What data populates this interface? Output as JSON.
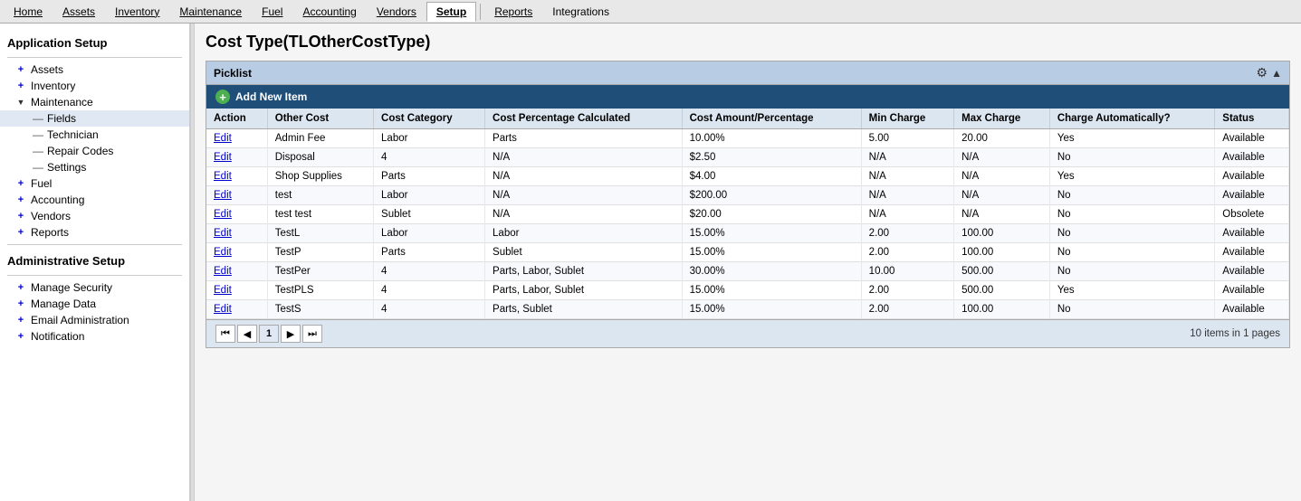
{
  "topnav": {
    "items": [
      {
        "label": "Home",
        "id": "home",
        "active": false,
        "underline": true
      },
      {
        "label": "Assets",
        "id": "assets",
        "active": false,
        "underline": true
      },
      {
        "label": "Inventory",
        "id": "inventory",
        "active": false,
        "underline": true
      },
      {
        "label": "Maintenance",
        "id": "maintenance",
        "active": false,
        "underline": true
      },
      {
        "label": "Fuel",
        "id": "fuel",
        "active": false,
        "underline": true
      },
      {
        "label": "Accounting",
        "id": "accounting",
        "active": false,
        "underline": true
      },
      {
        "label": "Vendors",
        "id": "vendors",
        "active": false,
        "underline": true
      },
      {
        "label": "Setup",
        "id": "setup",
        "active": true,
        "underline": true
      },
      {
        "label": "Reports",
        "id": "reports",
        "active": false,
        "underline": true
      },
      {
        "label": "Integrations",
        "id": "integrations",
        "active": false,
        "underline": false
      }
    ]
  },
  "sidebar": {
    "app_setup_title": "Application Setup",
    "admin_setup_title": "Administrative Setup",
    "app_items": [
      {
        "label": "Assets",
        "id": "assets"
      },
      {
        "label": "Inventory",
        "id": "inventory"
      },
      {
        "label": "Maintenance",
        "id": "maintenance",
        "expanded": true
      },
      {
        "label": "Fields",
        "id": "fields",
        "sub": true,
        "selected": true
      },
      {
        "label": "Technician",
        "id": "technician",
        "sub": true
      },
      {
        "label": "Repair Codes",
        "id": "repair-codes",
        "sub": true
      },
      {
        "label": "Settings",
        "id": "settings",
        "sub": true
      },
      {
        "label": "Fuel",
        "id": "fuel"
      },
      {
        "label": "Accounting",
        "id": "accounting"
      },
      {
        "label": "Vendors",
        "id": "vendors"
      },
      {
        "label": "Reports",
        "id": "reports"
      }
    ],
    "admin_items": [
      {
        "label": "Manage Security",
        "id": "manage-security"
      },
      {
        "label": "Manage Data",
        "id": "manage-data"
      },
      {
        "label": "Email Administration",
        "id": "email-admin"
      },
      {
        "label": "Notification",
        "id": "notification"
      }
    ]
  },
  "page": {
    "title": "Cost Type(TLOtherCostType)"
  },
  "picklist": {
    "header": "Picklist",
    "add_new_label": "Add New Item",
    "columns": [
      {
        "label": "Action",
        "id": "action"
      },
      {
        "label": "Other Cost",
        "id": "other-cost"
      },
      {
        "label": "Cost Category",
        "id": "cost-category"
      },
      {
        "label": "Cost Percentage Calculated",
        "id": "cost-pct-calc"
      },
      {
        "label": "Cost Amount/Percentage",
        "id": "cost-amt-pct"
      },
      {
        "label": "Min Charge",
        "id": "min-charge"
      },
      {
        "label": "Max Charge",
        "id": "max-charge"
      },
      {
        "label": "Charge Automatically?",
        "id": "charge-auto"
      },
      {
        "label": "Status",
        "id": "status"
      }
    ],
    "rows": [
      {
        "action": "Edit",
        "other_cost": "Admin Fee",
        "cost_category": "Labor",
        "cost_pct_calc": "Parts",
        "cost_amt_pct": "10.00%",
        "min_charge": "5.00",
        "max_charge": "20.00",
        "charge_auto": "Yes",
        "status": "Available"
      },
      {
        "action": "Edit",
        "other_cost": "Disposal",
        "cost_category": "4",
        "cost_pct_calc": "N/A",
        "cost_amt_pct": "$2.50",
        "min_charge": "N/A",
        "max_charge": "N/A",
        "charge_auto": "No",
        "status": "Available"
      },
      {
        "action": "Edit",
        "other_cost": "Shop Supplies",
        "cost_category": "Parts",
        "cost_pct_calc": "N/A",
        "cost_amt_pct": "$4.00",
        "min_charge": "N/A",
        "max_charge": "N/A",
        "charge_auto": "Yes",
        "status": "Available"
      },
      {
        "action": "Edit",
        "other_cost": "test",
        "cost_category": "Labor",
        "cost_pct_calc": "N/A",
        "cost_amt_pct": "$200.00",
        "min_charge": "N/A",
        "max_charge": "N/A",
        "charge_auto": "No",
        "status": "Available"
      },
      {
        "action": "Edit",
        "other_cost": "test test",
        "cost_category": "Sublet",
        "cost_pct_calc": "N/A",
        "cost_amt_pct": "$20.00",
        "min_charge": "N/A",
        "max_charge": "N/A",
        "charge_auto": "No",
        "status": "Obsolete"
      },
      {
        "action": "Edit",
        "other_cost": "TestL",
        "cost_category": "Labor",
        "cost_pct_calc": "Labor",
        "cost_amt_pct": "15.00%",
        "min_charge": "2.00",
        "max_charge": "100.00",
        "charge_auto": "No",
        "status": "Available"
      },
      {
        "action": "Edit",
        "other_cost": "TestP",
        "cost_category": "Parts",
        "cost_pct_calc": "Sublet",
        "cost_amt_pct": "15.00%",
        "min_charge": "2.00",
        "max_charge": "100.00",
        "charge_auto": "No",
        "status": "Available"
      },
      {
        "action": "Edit",
        "other_cost": "TestPer",
        "cost_category": "4",
        "cost_pct_calc": "Parts, Labor, Sublet",
        "cost_amt_pct": "30.00%",
        "min_charge": "10.00",
        "max_charge": "500.00",
        "charge_auto": "No",
        "status": "Available"
      },
      {
        "action": "Edit",
        "other_cost": "TestPLS",
        "cost_category": "4",
        "cost_pct_calc": "Parts, Labor, Sublet",
        "cost_amt_pct": "15.00%",
        "min_charge": "2.00",
        "max_charge": "500.00",
        "charge_auto": "Yes",
        "status": "Available"
      },
      {
        "action": "Edit",
        "other_cost": "TestS",
        "cost_category": "4",
        "cost_pct_calc": "Parts, Sublet",
        "cost_amt_pct": "15.00%",
        "min_charge": "2.00",
        "max_charge": "100.00",
        "charge_auto": "No",
        "status": "Available"
      }
    ],
    "pagination": {
      "first": "⏮",
      "prev": "◀",
      "current_page": "1",
      "next": "▶",
      "last": "⏭",
      "info": "10 items in 1 pages"
    }
  }
}
